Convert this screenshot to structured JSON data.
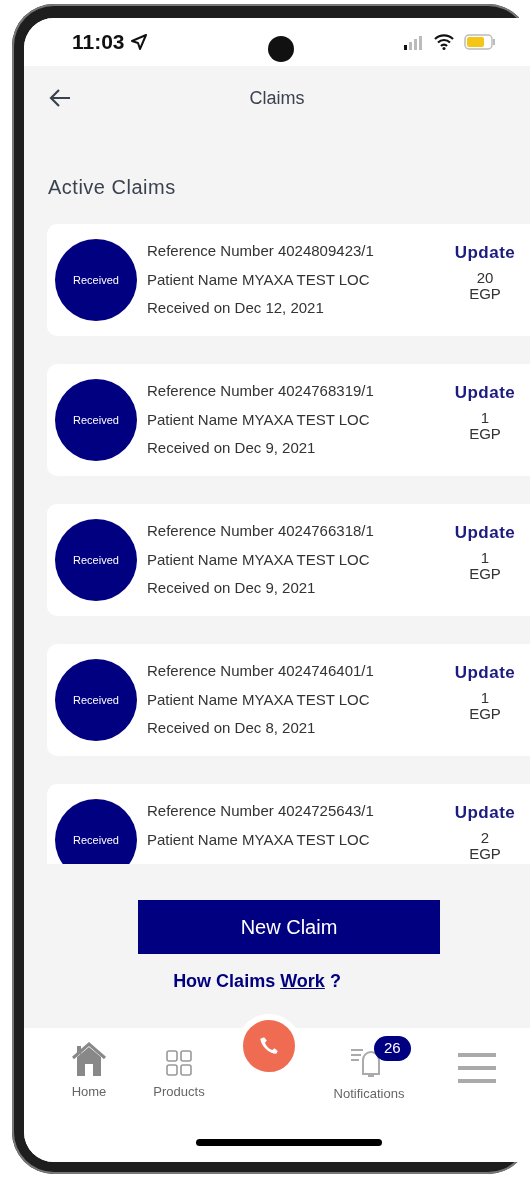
{
  "status_bar": {
    "time": "11:03"
  },
  "header": {
    "title": "Claims"
  },
  "section_title": "Active Claims",
  "claims": [
    {
      "status": "Received",
      "reference": "Reference Number 4024809423/1",
      "patient": "Patient Name MYAXA TEST LOC",
      "received": "Received on Dec 12, 2021",
      "action": "Update",
      "amount": "20",
      "currency": "EGP"
    },
    {
      "status": "Received",
      "reference": "Reference Number 4024768319/1",
      "patient": "Patient Name MYAXA TEST LOC",
      "received": "Received on Dec 9, 2021",
      "action": "Update",
      "amount": "1",
      "currency": "EGP"
    },
    {
      "status": "Received",
      "reference": "Reference Number 4024766318/1",
      "patient": "Patient Name MYAXA TEST LOC",
      "received": "Received on Dec 9, 2021",
      "action": "Update",
      "amount": "1",
      "currency": "EGP"
    },
    {
      "status": "Received",
      "reference": "Reference Number 4024746401/1",
      "patient": "Patient Name MYAXA TEST LOC",
      "received": "Received on Dec 8, 2021",
      "action": "Update",
      "amount": "1",
      "currency": "EGP"
    },
    {
      "status": "Received",
      "reference": "Reference Number 4024725643/1",
      "patient": "Patient Name MYAXA TEST LOC",
      "action": "Update",
      "amount": "2",
      "currency": "EGP"
    }
  ],
  "new_claim_button": "New Claim",
  "help_link": {
    "text": "How Claims",
    "link": "Work",
    "suffix": "?"
  },
  "bottom_nav": [
    {
      "kind": "home",
      "label": "Home"
    },
    {
      "kind": "products",
      "label": "Products"
    },
    {
      "kind": "call"
    },
    {
      "kind": "notifications",
      "label": "Notifications",
      "badge": "26"
    },
    {
      "kind": "menu"
    }
  ]
}
